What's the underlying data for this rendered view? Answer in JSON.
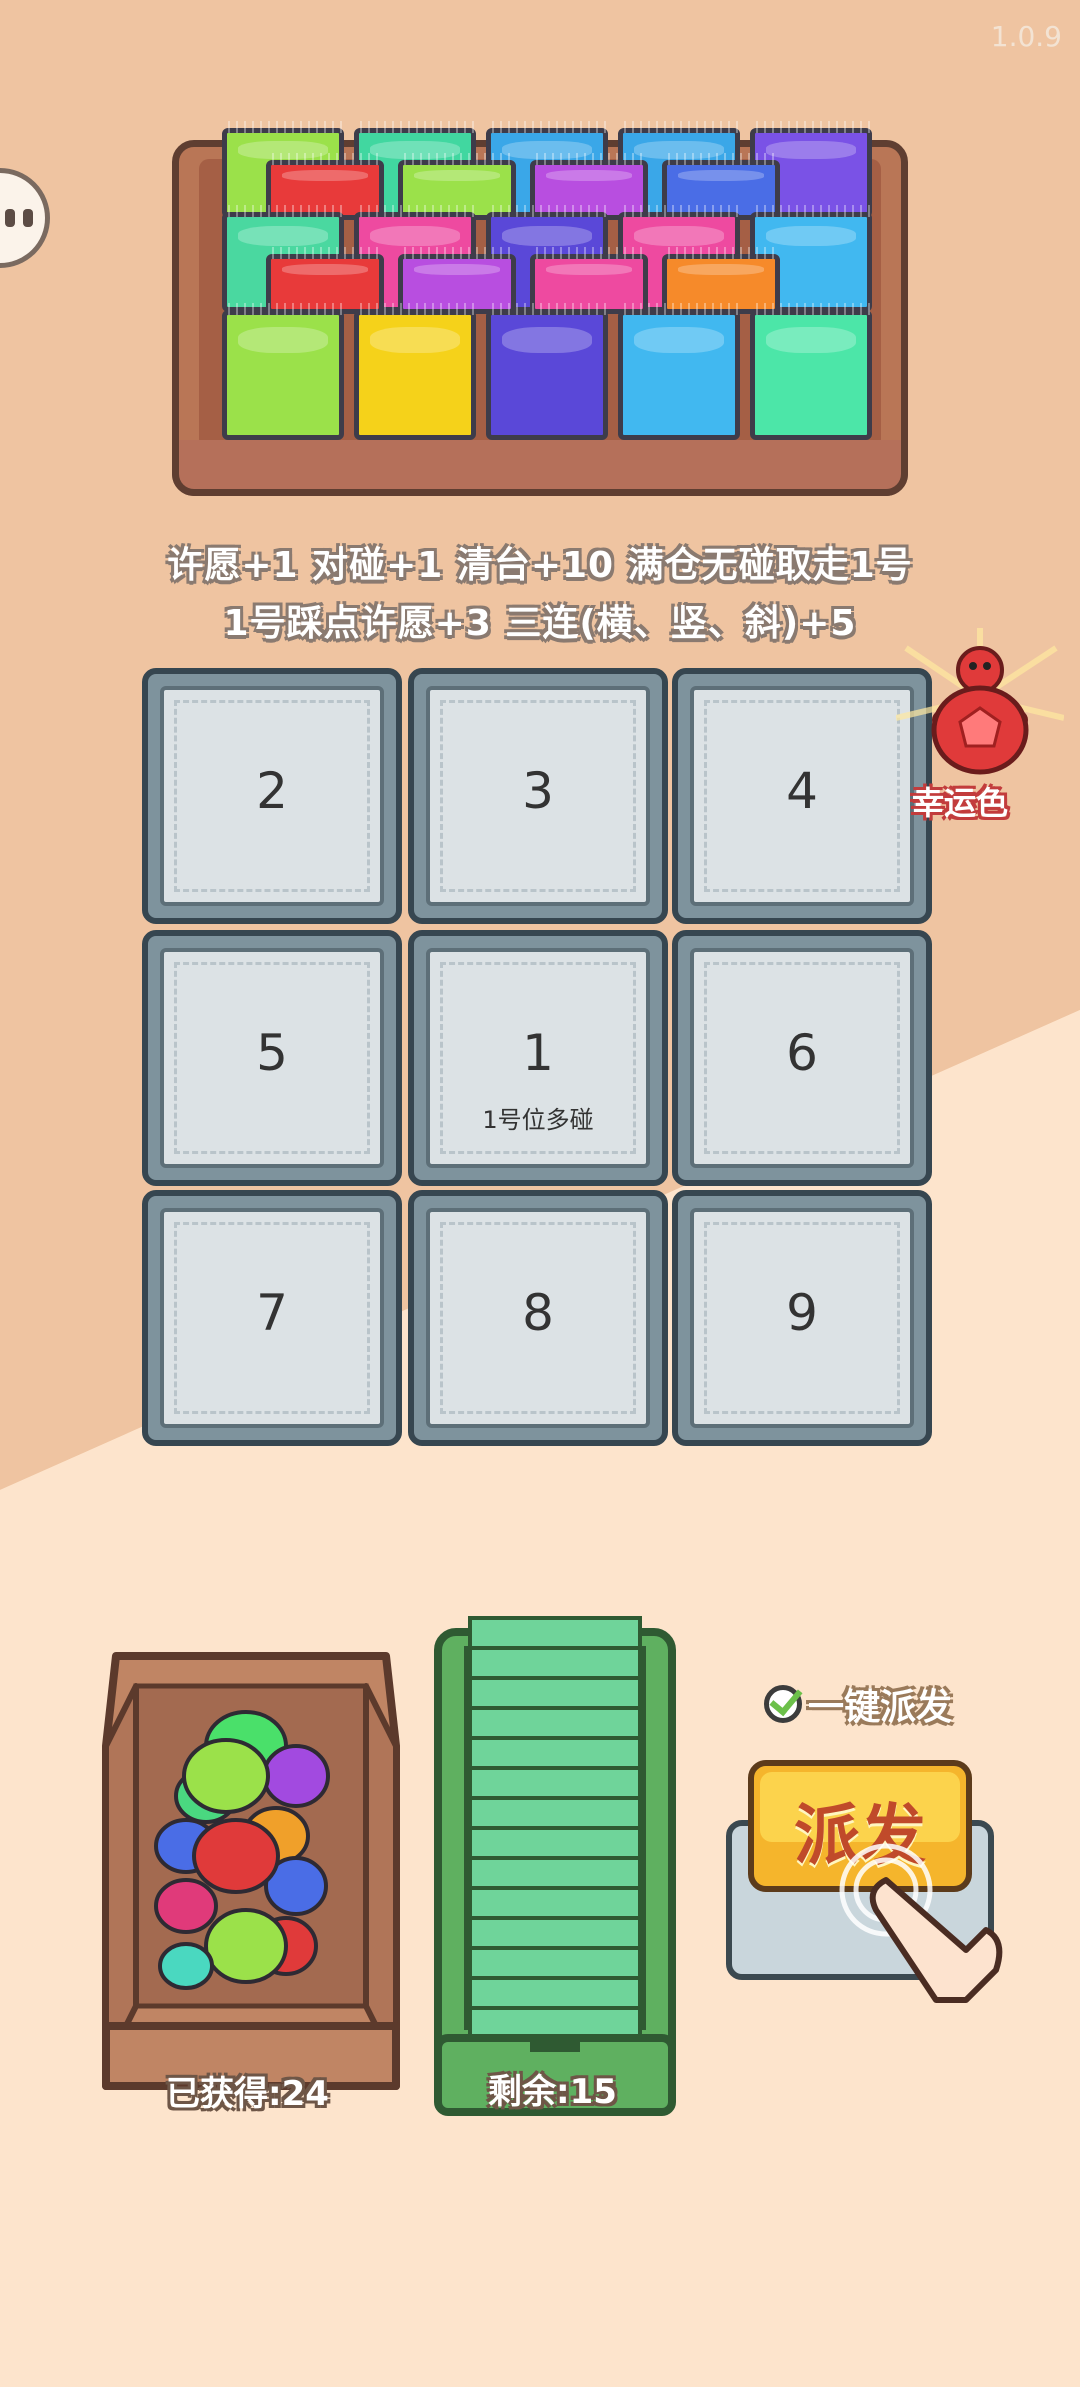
{
  "version": "1.0.9",
  "rules": {
    "line1": "许愿+1 对碰+1 清台+10 满仓无碰取走1号",
    "line2": "1号踩点许愿+3 三连(横、竖、斜)+5"
  },
  "lucky": {
    "label": "幸运色",
    "color": "#e03a3a"
  },
  "tray": {
    "rows": [
      [
        "#9be14a",
        "#41d7a0",
        "#3aa7e8",
        "#3aa7e8",
        "#7a52e6"
      ],
      [
        "#e83a3a",
        "#9be14a",
        "#b84ee0",
        "#4a6de6"
      ],
      [
        "#4ad8a0",
        "#ee4aa0",
        "#5a48d8",
        "#ee4aa0",
        "#41b8f0"
      ],
      [
        "#e83a3a",
        "#b84ee0",
        "#ee4aa0",
        "#f68a2a"
      ],
      [
        "#9be14a",
        "#f5d21a",
        "#5a48d8",
        "#41b8f0",
        "#4ce6a8"
      ]
    ]
  },
  "grid": {
    "cells": [
      {
        "num": "2",
        "sub": ""
      },
      {
        "num": "3",
        "sub": ""
      },
      {
        "num": "4",
        "sub": ""
      },
      {
        "num": "5",
        "sub": ""
      },
      {
        "num": "1",
        "sub": "1号位多碰"
      },
      {
        "num": "6",
        "sub": ""
      },
      {
        "num": "7",
        "sub": ""
      },
      {
        "num": "8",
        "sub": ""
      },
      {
        "num": "9",
        "sub": ""
      }
    ]
  },
  "collected": {
    "label": "已获得:24"
  },
  "remaining": {
    "label": "剩余:15"
  },
  "auto_dispatch": {
    "label": "一键派发",
    "checked": true
  },
  "dispatch_button": {
    "label": "派发"
  }
}
